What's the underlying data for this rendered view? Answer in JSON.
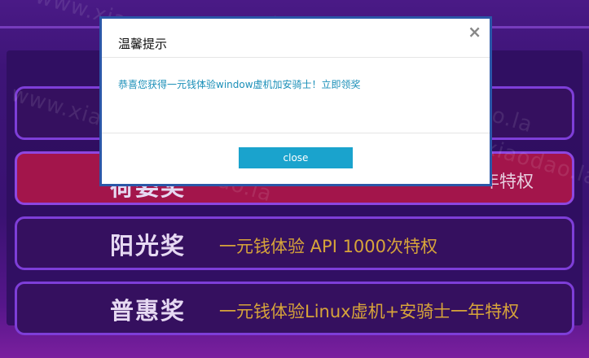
{
  "prizes": [
    {
      "name": "",
      "desc": ""
    },
    {
      "name": "荷姿奖",
      "desc": "一年特权"
    },
    {
      "name": "阳光奖",
      "desc": "一元钱体验 API 1000次特权"
    },
    {
      "name": "普惠奖",
      "desc": "一元钱体验Linux虚机+安骑士一年特权"
    }
  ],
  "modal": {
    "title": "温馨提示",
    "message": "恭喜您获得一元钱体验window虚机加安骑士！立即领奖",
    "button_label": "close",
    "close_icon": "×"
  },
  "watermark": {
    "text": "www.xiaodao.la"
  },
  "colors": {
    "accent_button": "#1aa3cd",
    "message_text": "#1a8fb8",
    "highlight_row": "#a3154b",
    "prize_desc": "#d7a43a"
  }
}
